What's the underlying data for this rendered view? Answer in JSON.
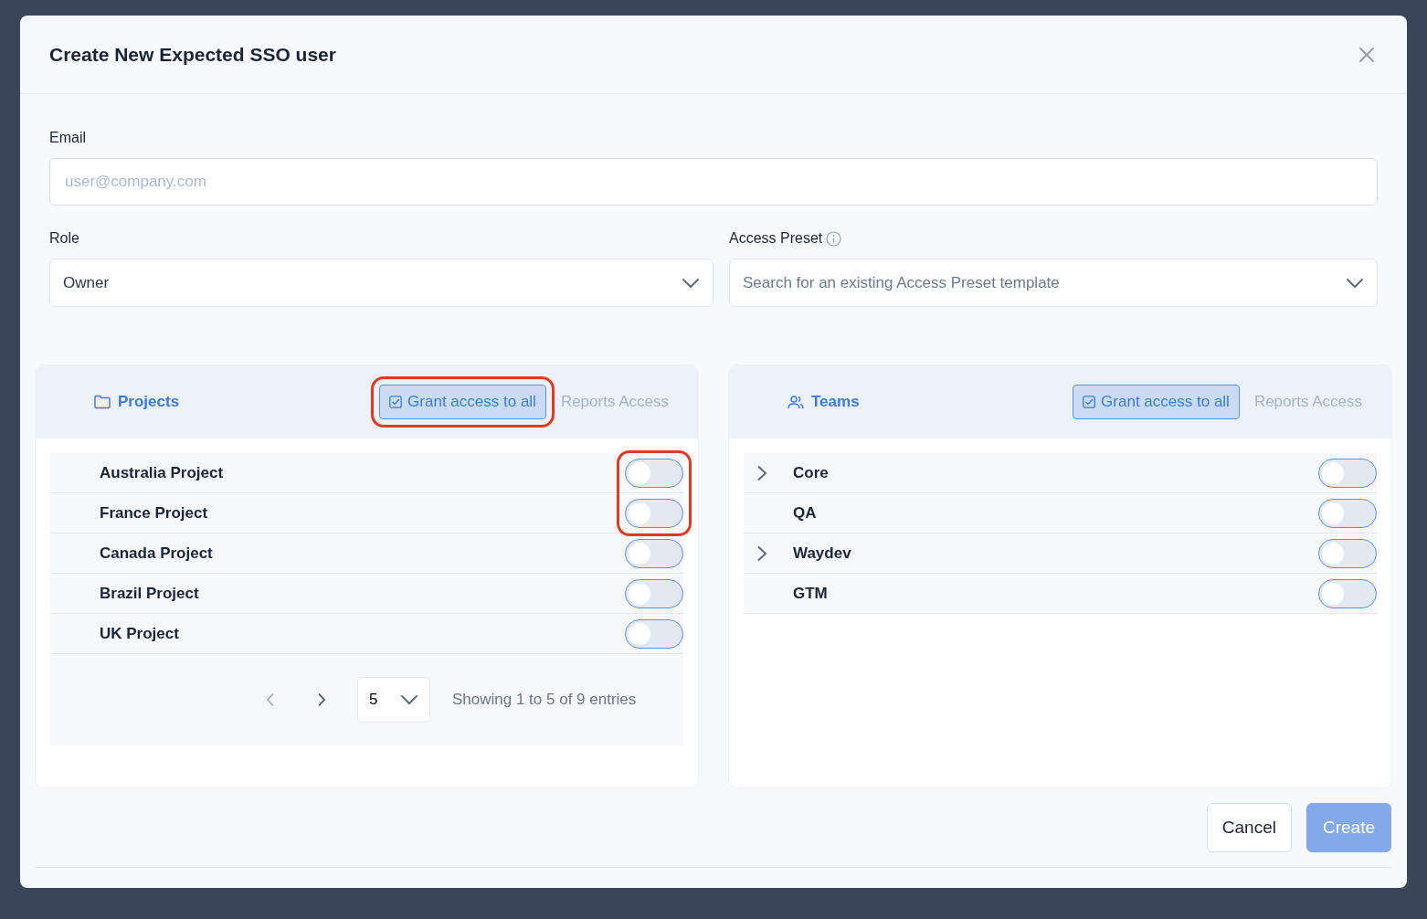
{
  "dialog": {
    "title": "Create New Expected SSO user"
  },
  "email": {
    "label": "Email",
    "placeholder": "user@company.com"
  },
  "role": {
    "label": "Role",
    "value": "Owner"
  },
  "access_preset": {
    "label": "Access Preset",
    "placeholder": "Search for an existing Access Preset template"
  },
  "panels": [
    {
      "kind": "projects",
      "title": "Projects",
      "grant_button": {
        "label": "Grant access to all",
        "highlighted": true
      },
      "reports_label": "Reports Access",
      "rows": [
        {
          "name": "Australia Project",
          "on": false,
          "highlighted": true
        },
        {
          "name": "France Project",
          "on": false,
          "highlighted": true
        },
        {
          "name": "Canada Project",
          "on": false,
          "highlighted": false
        },
        {
          "name": "Brazil Project",
          "on": false,
          "highlighted": false
        },
        {
          "name": "UK Project",
          "on": false,
          "highlighted": false
        }
      ],
      "pagination": {
        "page_size": "5",
        "summary": "Showing 1 to 5 of 9 entries"
      }
    },
    {
      "kind": "teams",
      "title": "Teams",
      "grant_button": {
        "label": "Grant access to all",
        "highlighted": false
      },
      "reports_label": "Reports Access",
      "rows": [
        {
          "name": "Core",
          "on": false,
          "expandable": true,
          "highlighted": false
        },
        {
          "name": "QA",
          "on": false,
          "expandable": false,
          "highlighted": false
        },
        {
          "name": "Waydev",
          "on": false,
          "expandable": true,
          "highlighted": false
        },
        {
          "name": "GTM",
          "on": false,
          "expandable": false,
          "highlighted": false
        }
      ]
    }
  ],
  "buttons": [
    {
      "kind": "secondary",
      "label": "Cancel",
      "disabled": false
    },
    {
      "kind": "primary",
      "label": "Create",
      "disabled": true
    }
  ]
}
